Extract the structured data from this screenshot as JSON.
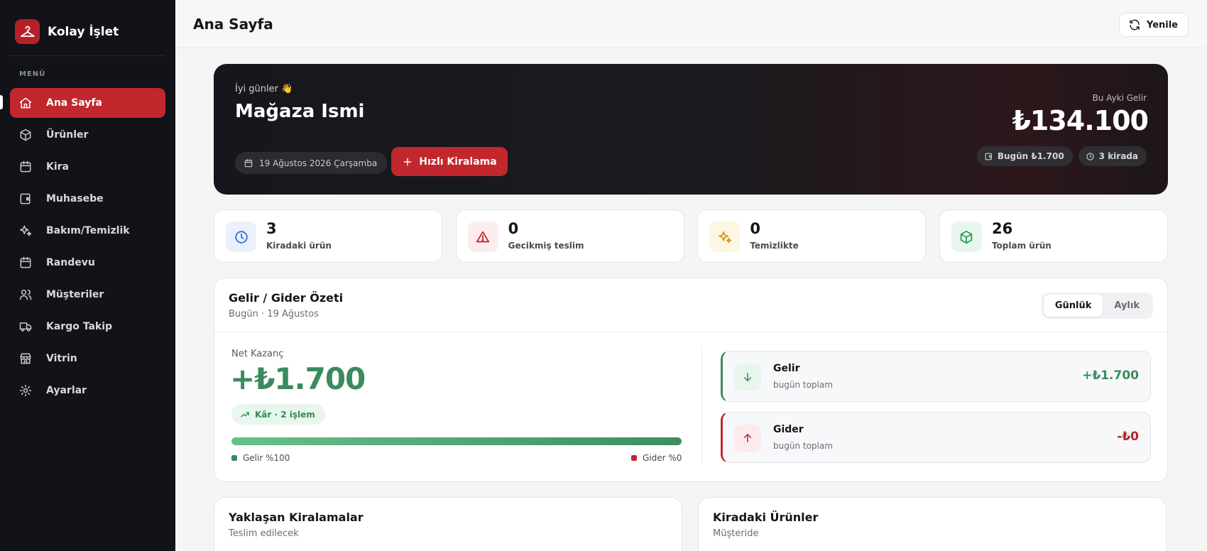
{
  "brand": {
    "name": "Kolay İşlet"
  },
  "sidebar": {
    "menu_label": "MENÜ",
    "items": [
      {
        "label": "Ana Sayfa",
        "icon": "home-icon",
        "active": true
      },
      {
        "label": "Ürünler",
        "icon": "box-icon"
      },
      {
        "label": "Kira",
        "icon": "calendar-icon"
      },
      {
        "label": "Muhasebe",
        "icon": "wallet-icon"
      },
      {
        "label": "Bakım/Temizlik",
        "icon": "sparkles-icon"
      },
      {
        "label": "Randevu",
        "icon": "calendar-icon"
      },
      {
        "label": "Müşteriler",
        "icon": "users-icon"
      },
      {
        "label": "Kargo Takip",
        "icon": "truck-icon"
      },
      {
        "label": "Vitrin",
        "icon": "store-icon"
      },
      {
        "label": "Ayarlar",
        "icon": "gear-icon"
      }
    ]
  },
  "header": {
    "title": "Ana Sayfa",
    "refresh_label": "Yenile"
  },
  "hero": {
    "greeting": "İyi günler 👋",
    "store_name": "Mağaza Ismi",
    "date": "19 Ağustos 2026 Çarşamba",
    "quick_rent_label": "Hızlı Kiralama",
    "monthly_income_label": "Bu Ayki Gelir",
    "monthly_income_value": "₺134.100",
    "today_chip": "Bugün ₺1.700",
    "rented_chip": "3 kirada"
  },
  "stats": [
    {
      "value": "3",
      "label": "Kiradaki ürün",
      "icon": "clock-icon",
      "color": "#2f6fe0",
      "bg": "#eaf1fd"
    },
    {
      "value": "0",
      "label": "Gecikmiş teslim",
      "icon": "warning-icon",
      "color": "#c1272d",
      "bg": "#fdeced"
    },
    {
      "value": "0",
      "label": "Temizlikte",
      "icon": "sparkles-icon",
      "color": "#d49a1c",
      "bg": "#fdf6e3"
    },
    {
      "value": "26",
      "label": "Toplam ürün",
      "icon": "box-icon",
      "color": "#2f9a5c",
      "bg": "#e8f7ee"
    }
  ],
  "summary": {
    "title": "Gelir / Gider Özeti",
    "subtitle": "Bugün · 19 Ağustos",
    "tabs": [
      "Günlük",
      "Aylık"
    ],
    "active_tab": "Günlük",
    "net_label": "Net Kazanç",
    "net_value": "+₺1.700",
    "profit_chip": "Kâr · 2 işlem",
    "income_share": 1.0,
    "legend_income": "Gelir %100",
    "legend_expense": "Gider %0",
    "income": {
      "title": "Gelir",
      "subtitle": "bugün toplam",
      "amount": "+₺1.700",
      "color": "#3a8b5e"
    },
    "expense": {
      "title": "Gider",
      "subtitle": "bugün toplam",
      "amount": "-₺0",
      "color": "#b3232a"
    }
  },
  "upcoming": {
    "title": "Yaklaşan Kiralamalar",
    "subtitle": "Teslim edilecek"
  },
  "rented": {
    "title": "Kiradaki Ürünler",
    "subtitle": "Müşteride"
  }
}
